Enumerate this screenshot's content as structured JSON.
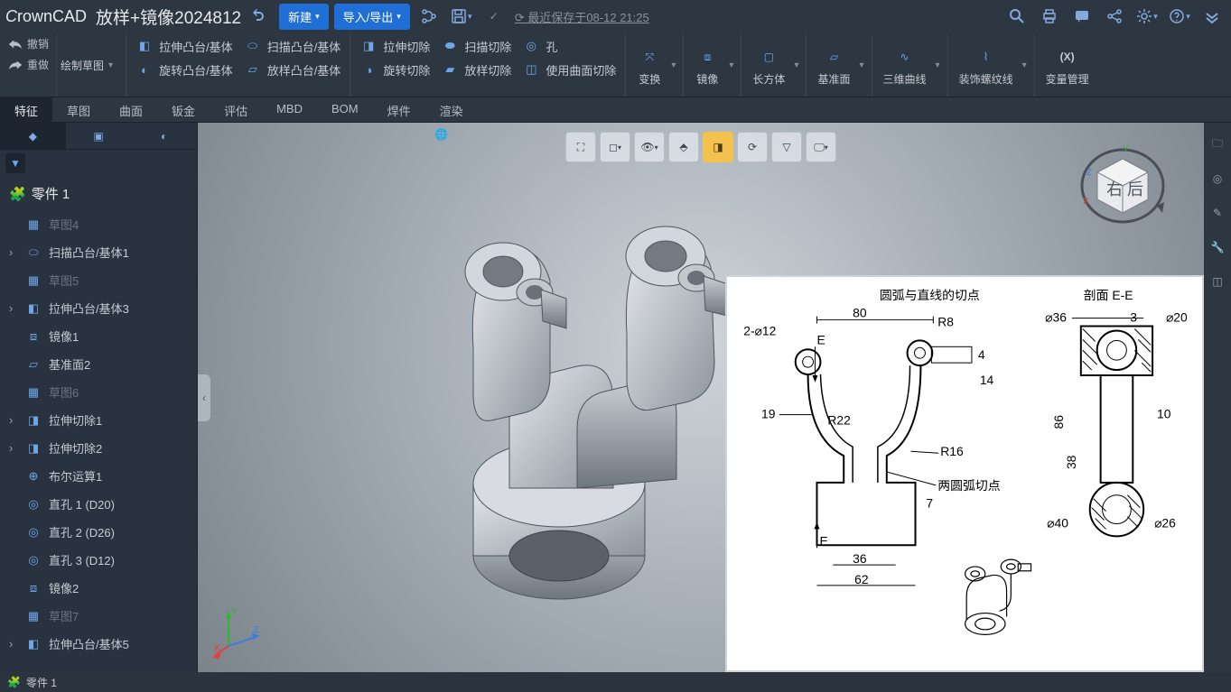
{
  "title": {
    "logo": "CrownCAD",
    "doc": "放样+镜像2024812"
  },
  "titlebar": {
    "new": "新建",
    "import": "导入/导出",
    "saved": "最近保存于08-12 21:25"
  },
  "undo": "撤销",
  "redo": "重做",
  "sketch_drop": "绘制草图",
  "ribbon": {
    "g1a": "拉伸凸台/基体",
    "g1b": "扫描凸台/基体",
    "g1c": "旋转凸台/基体",
    "g1d": "放样凸台/基体",
    "g2a": "拉伸切除",
    "g2b": "扫描切除",
    "g2c": "孔",
    "g2d": "旋转切除",
    "g2e": "放样切除",
    "g2f": "使用曲面切除",
    "b1": "变换",
    "b2": "镜像",
    "b3": "长方体",
    "b4": "基准面",
    "b5": "三维曲线",
    "b6": "装饰螺纹线",
    "b7": "(X)",
    "b7s": "变量管理"
  },
  "tabs": [
    "特征",
    "草图",
    "曲面",
    "钣金",
    "评估",
    "MBD",
    "BOM",
    "焊件",
    "渲染"
  ],
  "tree": {
    "part": "零件 1",
    "items": [
      {
        "label": "草图4",
        "dim": true,
        "icon": "sketch"
      },
      {
        "label": "扫描凸台/基体1",
        "caret": true,
        "icon": "sweep"
      },
      {
        "label": "草图5",
        "dim": true,
        "icon": "sketch"
      },
      {
        "label": "拉伸凸台/基体3",
        "caret": true,
        "icon": "extrude"
      },
      {
        "label": "镜像1",
        "icon": "mirror"
      },
      {
        "label": "基准面2",
        "icon": "plane"
      },
      {
        "label": "草图6",
        "dim": true,
        "icon": "sketch"
      },
      {
        "label": "拉伸切除1",
        "caret": true,
        "icon": "cut"
      },
      {
        "label": "拉伸切除2",
        "caret": true,
        "icon": "cut"
      },
      {
        "label": "布尔运算1",
        "icon": "bool"
      },
      {
        "label": "直孔 1 (D20)",
        "icon": "hole"
      },
      {
        "label": "直孔 2 (D26)",
        "icon": "hole"
      },
      {
        "label": "直孔 3 (D12)",
        "icon": "hole"
      },
      {
        "label": "镜像2",
        "icon": "mirror"
      },
      {
        "label": "草图7",
        "dim": true,
        "icon": "sketch"
      },
      {
        "label": "拉伸凸台/基体5",
        "caret": true,
        "icon": "extrude"
      }
    ]
  },
  "status": {
    "part": "零件 1"
  },
  "drawing": {
    "t1": "圆弧与直线的切点",
    "t2": "剖面 E-E",
    "d1": "2-⌀12",
    "d2": "80",
    "d3": "R8",
    "d4": "⌀36",
    "d5": "3",
    "d6": "⌀20",
    "d7": "E",
    "d8": "4",
    "d9": "14",
    "d10": "19",
    "d11": "R22",
    "d12": "86",
    "d13": "10",
    "d14": "R16",
    "d15": "38",
    "d16": "两圆弧切点",
    "d17": "7",
    "d18": "⌀40",
    "d19": "⌀26",
    "d20": "E",
    "d21": "36",
    "d22": "62"
  }
}
